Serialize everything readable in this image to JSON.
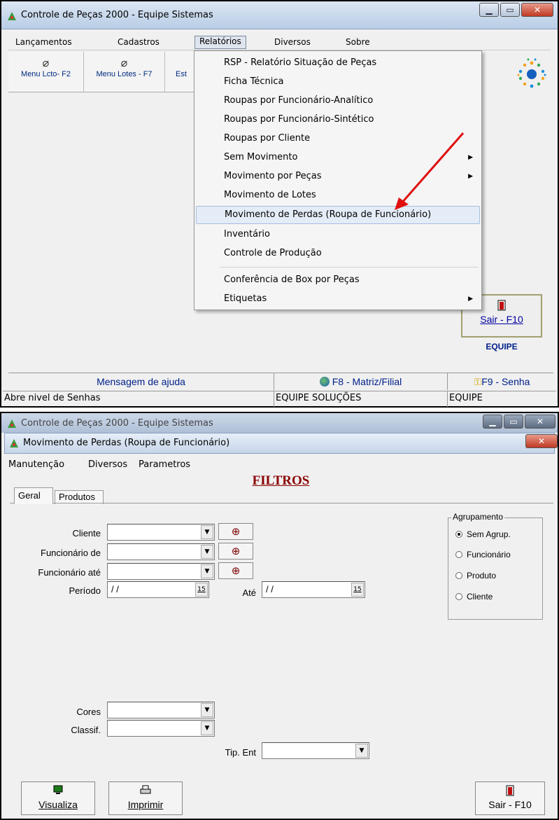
{
  "win1": {
    "title": "Controle de Peças 2000 - Equipe Sistemas",
    "menu": [
      "Lançamentos",
      "Cadastros",
      "Relatórios",
      "Diversos",
      "Sobre"
    ],
    "toolbar": [
      {
        "label": "Menu Lcto- F2",
        "icon": "book-icon"
      },
      {
        "label": "Menu Lotes - F7",
        "icon": "book-icon"
      },
      {
        "label": "Est",
        "icon": ""
      }
    ],
    "dropdown": [
      {
        "label": "RSP - Relatório Situação de Peças",
        "submenu": false
      },
      {
        "label": "Ficha Técnica",
        "submenu": false
      },
      {
        "label": "Roupas por Funcionário-Analítico",
        "submenu": false
      },
      {
        "label": "Roupas por Funcionário-Sintético",
        "submenu": false
      },
      {
        "label": "Roupas por Cliente",
        "submenu": false
      },
      {
        "label": "Sem Movimento",
        "submenu": true
      },
      {
        "label": "Movimento por Peças",
        "submenu": true
      },
      {
        "label": "Movimento de Lotes",
        "submenu": false
      },
      {
        "label": "Movimento de Perdas (Roupa de Funcionário)",
        "submenu": false,
        "highlighted": true
      },
      {
        "label": "Inventário",
        "submenu": false
      },
      {
        "label": "Controle de Produção",
        "submenu": false
      },
      {
        "label": "Conferência de Box por Peças",
        "submenu": false
      },
      {
        "label": "Etiquetas",
        "submenu": true
      }
    ],
    "sair_label": "Sair - F10",
    "equipe_label": "EQUIPE",
    "bottom": {
      "mensagem": "Mensagem de ajuda",
      "f8": "F8 - Matriz/Filial",
      "f9": "F9 - Senha"
    },
    "status": {
      "left": "Abre nivel de Senhas",
      "mid": "EQUIPE SOLUÇÕES",
      "right": "EQUIPE"
    },
    "accent_arrow_color": "#e01010"
  },
  "win2": {
    "bg_title": "Controle de Peças 2000 - Equipe Sistemas",
    "dialog_title": "Movimento de Perdas (Roupa de Funcionário)",
    "menu": [
      "Manutenção",
      "Diversos",
      "Parametros"
    ],
    "heading": "FILTROS",
    "tabs": [
      "Geral",
      "Produtos"
    ],
    "fields": {
      "cliente": "Cliente",
      "func_de": "Funcionário de",
      "func_ate": "Funcionário até",
      "periodo": "Período",
      "ate": "Até",
      "cores": "Cores",
      "classif": "Classif.",
      "tip_ent": "Tip. Ent",
      "date_value": "/ /",
      "calendar_text": "15"
    },
    "group": {
      "title": "Agrupamento",
      "options": [
        "Sem Agrup.",
        "Funcionário",
        "Produto",
        "Cliente"
      ],
      "selected": "Sem Agrup."
    },
    "buttons": {
      "visualiza": "Visualiza",
      "imprimir": "Imprimir",
      "sair": "Sair - F10"
    }
  }
}
